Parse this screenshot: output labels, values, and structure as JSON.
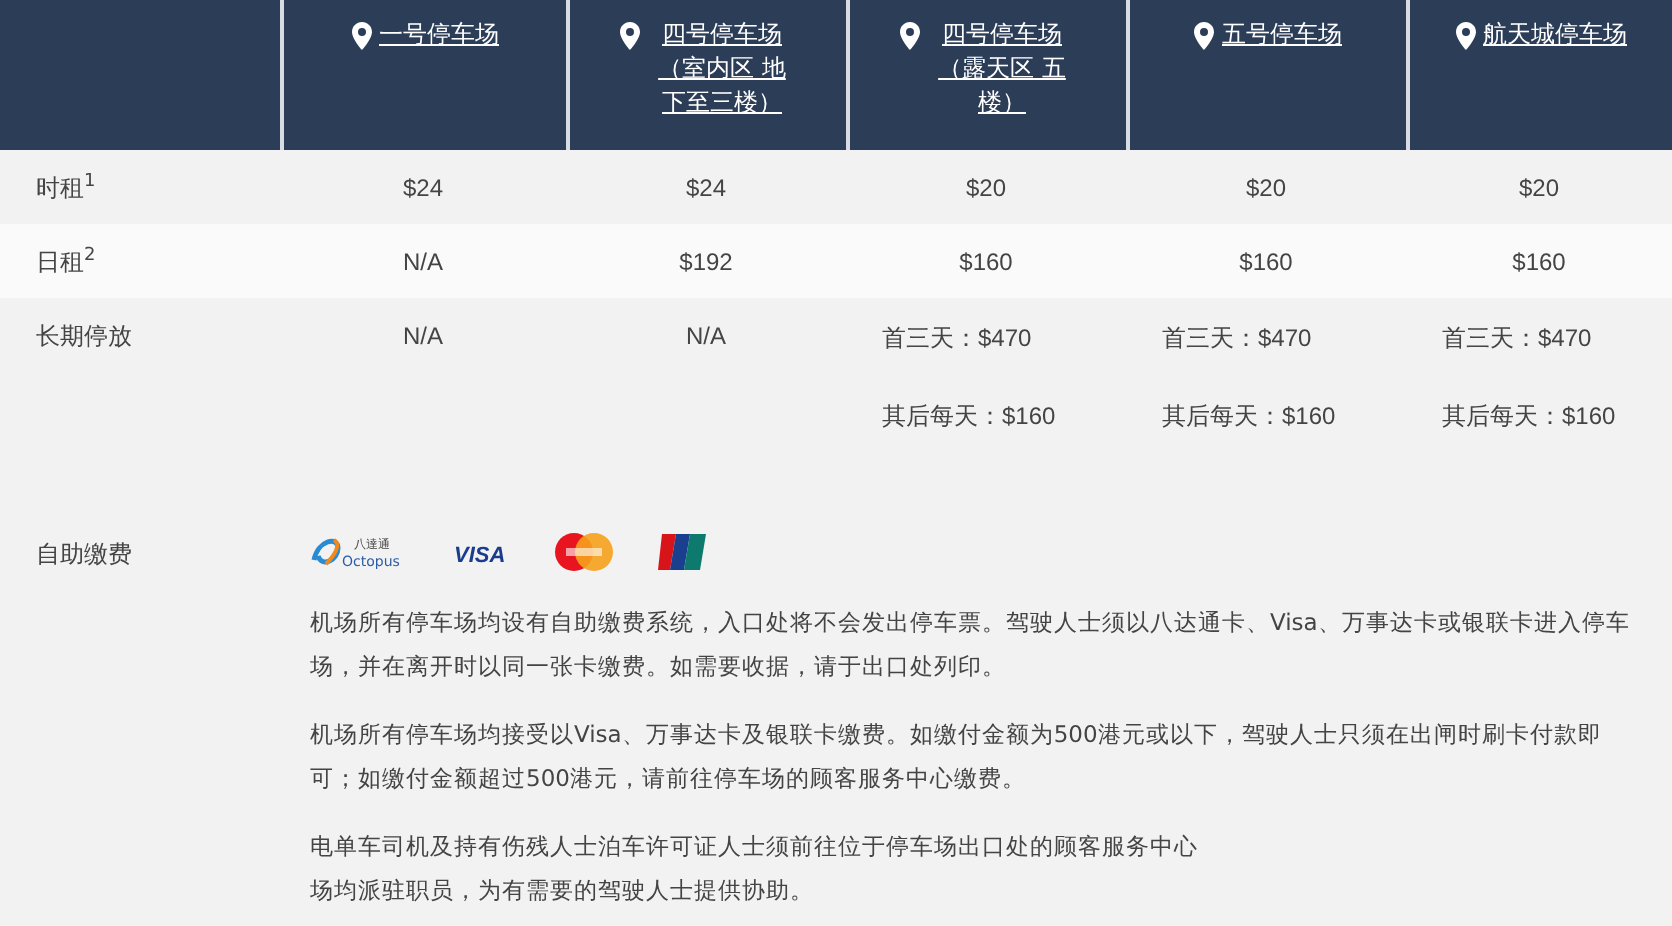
{
  "header": {
    "columns": [
      {
        "label": "一号停车场"
      },
      {
        "label": "四号停车场（室内区 地下至三楼）"
      },
      {
        "label": "四号停车场（露天区 五楼）"
      },
      {
        "label": "五号停车场"
      },
      {
        "label": "航天城停车场"
      }
    ]
  },
  "rows": [
    {
      "label": "时租$^{1}$",
      "cells": [
        [
          "$24"
        ],
        [
          "$24"
        ],
        [
          "$20"
        ],
        [
          "$20"
        ],
        [
          "$20"
        ]
      ]
    },
    {
      "label": "日租$^{2}$",
      "cells": [
        [
          "N/A"
        ],
        [
          "$192"
        ],
        [
          "$160"
        ],
        [
          "$160"
        ],
        [
          "$160"
        ]
      ]
    },
    {
      "label": "长期停放",
      "cells": [
        [
          "N/A"
        ],
        [
          "N/A"
        ],
        [
          "首三天：$470",
          "其后每天：$160"
        ],
        [
          "首三天：$470",
          "其后每天：$160"
        ],
        [
          "首三天：$470",
          "其后每天：$160"
        ]
      ]
    }
  ],
  "payment": {
    "label": "自助缴费",
    "methods": [
      {
        "kind": "octopus",
        "label": "Octopus",
        "sublabel": "八達通"
      },
      {
        "kind": "visa",
        "label": "VISA"
      },
      {
        "kind": "mastercard"
      },
      {
        "kind": "unionpay"
      }
    ],
    "paragraphs": [
      [
        "机场所有停车场均设有自助缴费系统，入口处将不会发出停车票。驾驶人士须以八达通卡、Visa、万事达卡或银联卡进入停车场，并在离开时以同一张卡缴费。如需要收据，请于出口处列印。"
      ],
      [
        "机场所有停车场均接受以Visa、万事达卡及银联卡缴费。如缴付金额为500港元或以下，驾驶人士只须在出闸时刷卡付款即可；如缴付金额超过500港元，请前往停车场的顾客服务中心缴费。"
      ],
      [
        "电单车司机及持有伤残人士泊车许可证人士须前往位于停车场出口处的顾客服务中心",
        "场均派驻职员，为有需要的驾驶人士提供协助。"
      ]
    ]
  }
}
